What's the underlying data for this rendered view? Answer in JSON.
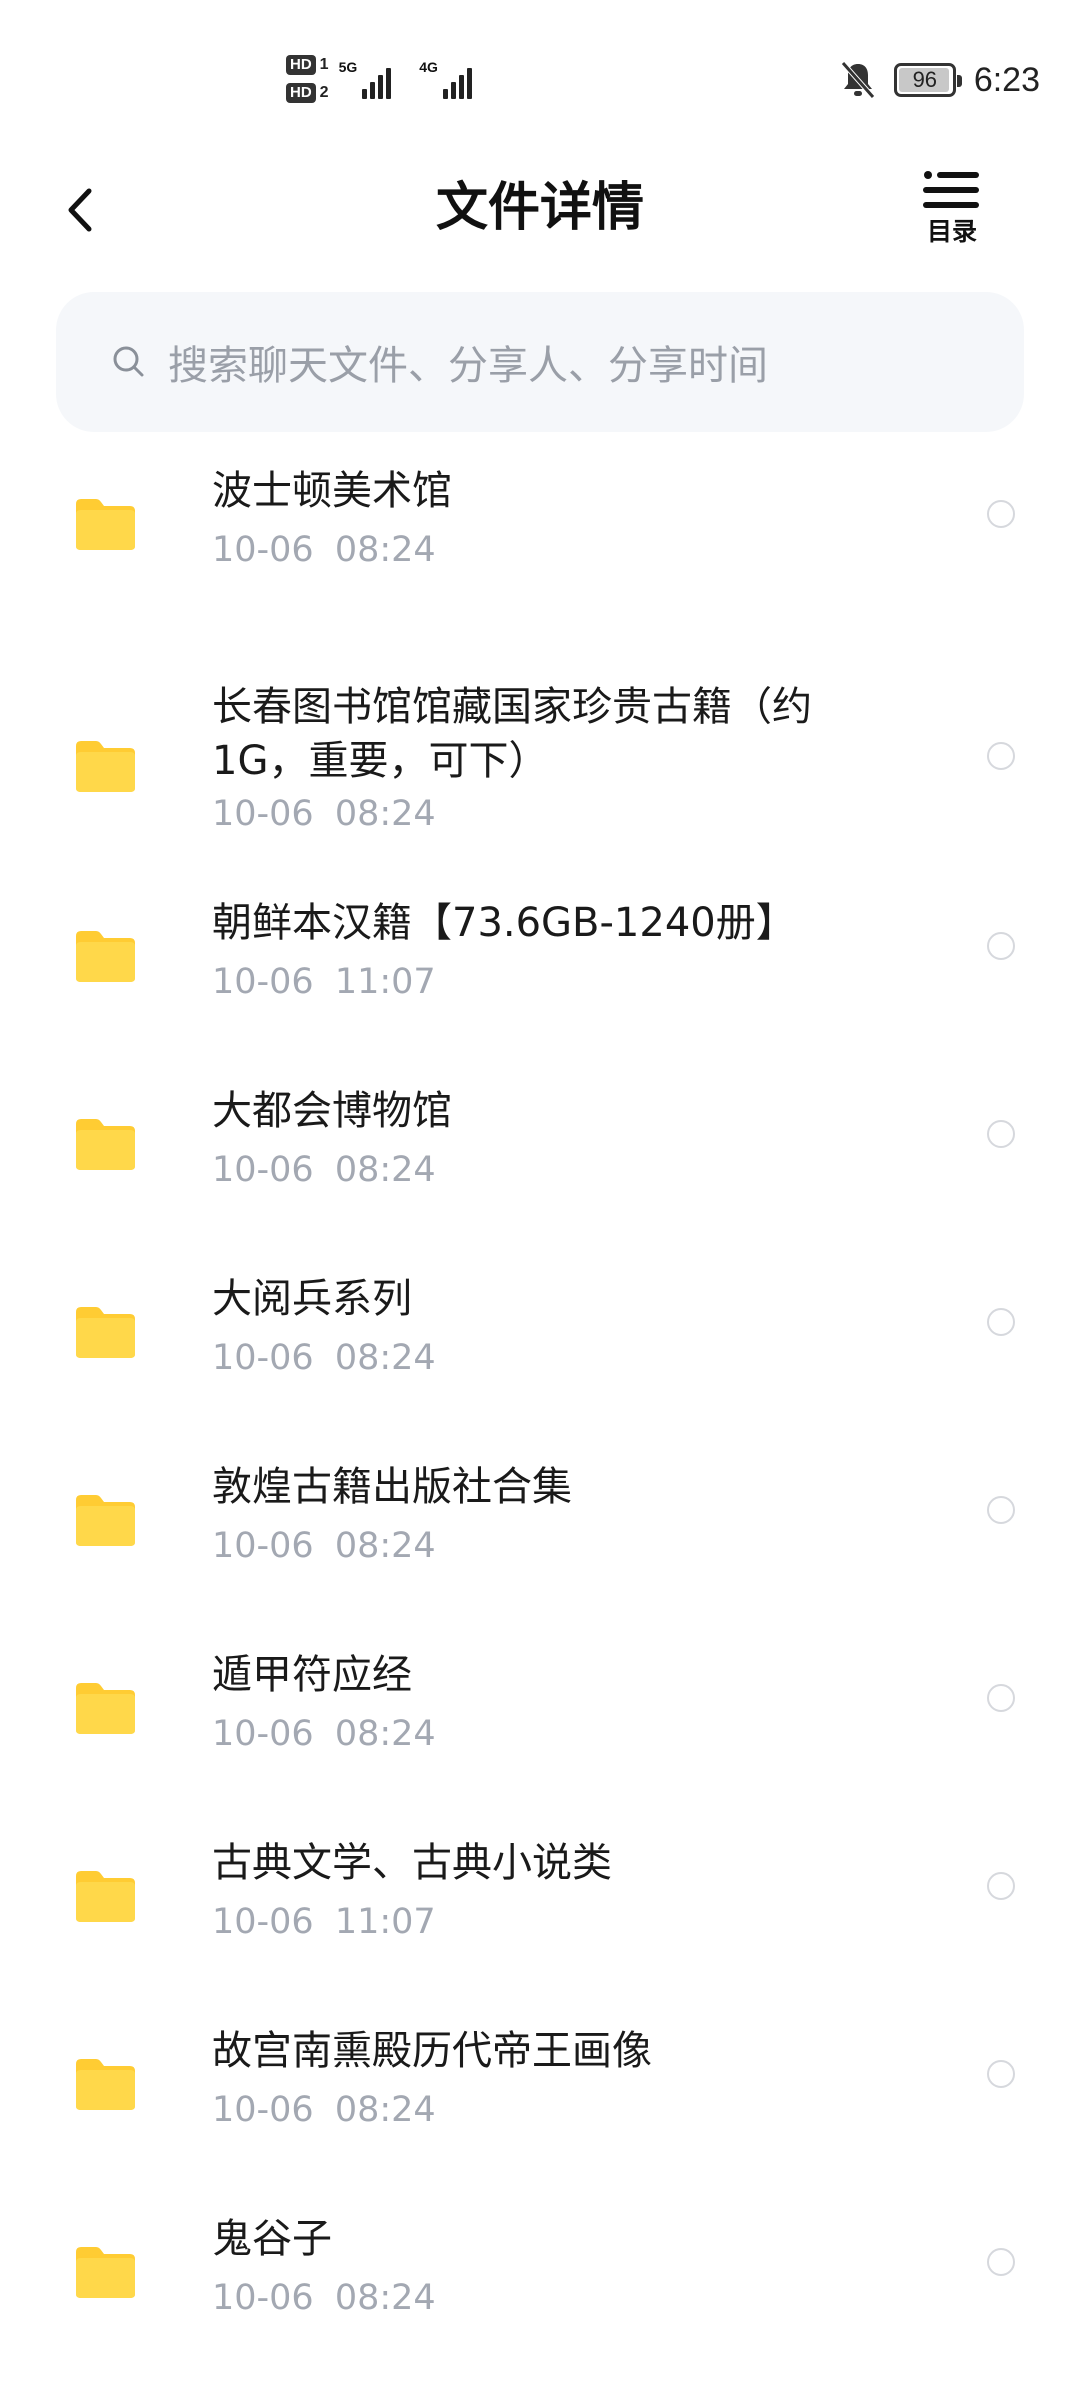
{
  "status_bar": {
    "hd1": "HD",
    "hd1_sim": "1",
    "hd2": "HD",
    "hd2_sim": "2",
    "net1": "5G",
    "net2": "4G",
    "battery": "96",
    "battery_level": 0.96,
    "time": "6:23",
    "icons": [
      "hd-icon",
      "signal-icon",
      "bell-off-icon",
      "battery-icon"
    ]
  },
  "header": {
    "title": "文件详情",
    "toc_label": "目录"
  },
  "search": {
    "placeholder": "搜索聊天文件、分享人、分享时间"
  },
  "files": [
    {
      "name": "波士顿美术馆",
      "date": "10-06 08:24"
    },
    {
      "name": "长春图书馆馆藏国家珍贵古籍（约1G，重要，可下）",
      "date": "10-06 08:24"
    },
    {
      "name": "朝鲜本汉籍【73.6GB-1240册】",
      "date": "10-06 11:07"
    },
    {
      "name": "大都会博物馆",
      "date": "10-06 08:24"
    },
    {
      "name": "大阅兵系列",
      "date": "10-06 08:24"
    },
    {
      "name": "敦煌古籍出版社合集",
      "date": "10-06 08:24"
    },
    {
      "name": "遁甲符应经",
      "date": "10-06 08:24"
    },
    {
      "name": "古典文学、古典小说类",
      "date": "10-06 11:07"
    },
    {
      "name": "故宫南熏殿历代帝王画像",
      "date": "10-06 08:24"
    },
    {
      "name": "鬼谷子",
      "date": "10-06 08:24"
    }
  ],
  "colors": {
    "folder": "#FFD84A",
    "folder_tab": "#FFCC33",
    "date_text": "#A3A8B2",
    "search_bg": "#F5F7FA"
  }
}
